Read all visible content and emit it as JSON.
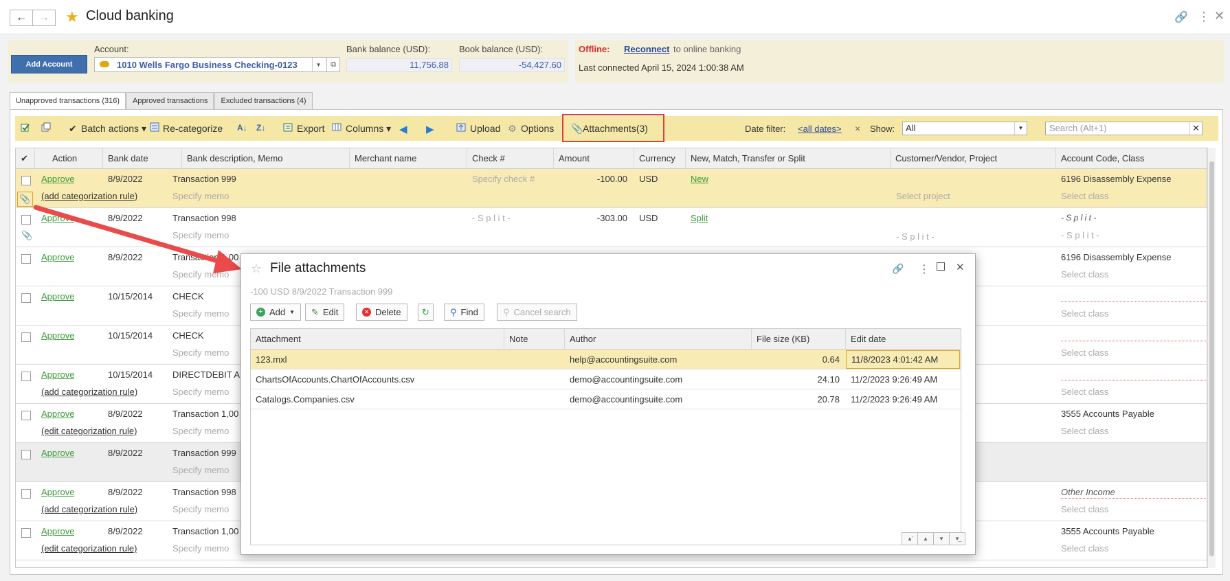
{
  "window": {
    "title": "Cloud banking"
  },
  "header": {
    "add_account": "Add Account",
    "account_label": "Account:",
    "account_value": "1010 Wells Fargo Business Checking-0123",
    "bank_balance_label": "Bank balance (USD):",
    "bank_balance": "11,756.88",
    "book_balance_label": "Book balance (USD):",
    "book_balance": "-54,427.60",
    "offline_label": "Offline:",
    "reconnect": "Reconnect",
    "reconnect_tail": "to online banking",
    "last_connected": "Last connected April 15, 2024 1:00:38 AM"
  },
  "tabs": [
    {
      "label": "Unapproved transactions (316)"
    },
    {
      "label": "Approved transactions"
    },
    {
      "label": "Excluded transactions (4)"
    }
  ],
  "toolbar": {
    "batch_actions": "Batch actions",
    "recategorize": "Re-categorize",
    "export": "Export",
    "columns": "Columns",
    "upload": "Upload",
    "options": "Options",
    "attachments": "Attachments(3)",
    "date_filter_label": "Date filter:",
    "date_filter_value": "<all dates>",
    "clear": "×",
    "show_label": "Show:",
    "show_value": "All",
    "search_placeholder": "Search (Alt+1)"
  },
  "grid": {
    "columns": [
      "Action",
      "Bank date",
      "Bank description, Memo",
      "Merchant name",
      "Check #",
      "Amount",
      "Currency",
      "New, Match, Transfer or Split",
      "Customer/Vendor, Project",
      "Account Code, Class"
    ],
    "rows": [
      {
        "action": "Approve",
        "date": "8/9/2022",
        "desc": "Transaction 999",
        "memo": "Specify memo",
        "rule": "(add categorization rule)",
        "check": "Specify check #",
        "amount": "-100.00",
        "currency": "USD",
        "match": "New",
        "project": "Select project",
        "account": "6196 Disassembly Expense",
        "class": "Select class"
      },
      {
        "action": "Approve",
        "date": "8/9/2022",
        "desc": "Transaction 998",
        "memo": "Specify memo",
        "rule": "",
        "check": "- S p l i t -",
        "amount": "-303.00",
        "currency": "USD",
        "match": "Split",
        "project": "- S p l i t -",
        "account": "- S p l i t -",
        "class": "- S p l i t -"
      },
      {
        "action": "Approve",
        "date": "8/9/2022",
        "desc": "Transaction 1,00",
        "memo": "Specify memo",
        "rule": "",
        "account": "6196 Disassembly Expense",
        "class": "Select class"
      },
      {
        "action": "Approve",
        "date": "10/15/2014",
        "desc": "CHECK",
        "memo": "Specify memo",
        "rule": "",
        "account": "",
        "class": "Select class"
      },
      {
        "action": "Approve",
        "date": "10/15/2014",
        "desc": "CHECK",
        "memo": "Specify memo",
        "rule": "",
        "account": "",
        "class": "Select class"
      },
      {
        "action": "Approve",
        "date": "10/15/2014",
        "desc": "DIRECTDEBIT A",
        "memo": "Specify memo",
        "rule": "(add categorization rule)",
        "account": "",
        "class": "Select class"
      },
      {
        "action": "Approve",
        "date": "8/9/2022",
        "desc": "Transaction 1,00",
        "memo": "Specify memo",
        "rule": "(edit categorization rule)",
        "account": "3555 Accounts Payable",
        "class": "Select class"
      },
      {
        "action": "Approve",
        "date": "8/9/2022",
        "desc": "Transaction 999",
        "memo": "Specify memo",
        "rule": "",
        "account": "",
        "class": ""
      },
      {
        "action": "Approve",
        "date": "8/9/2022",
        "desc": "Transaction 998",
        "memo": "Specify memo",
        "rule": "(add categorization rule)",
        "account": "Other Income",
        "class": "Select class"
      },
      {
        "action": "Approve",
        "date": "8/9/2022",
        "desc": "Transaction 1,00",
        "memo": "Specify memo",
        "rule": "(edit categorization rule)",
        "account": "3555 Accounts Payable",
        "class": "Select class"
      }
    ]
  },
  "dialog": {
    "title": "File attachments",
    "subtitle": "-100 USD 8/9/2022 Transaction 999",
    "buttons": {
      "add": "Add",
      "edit": "Edit",
      "delete": "Delete",
      "find": "Find",
      "cancel_search": "Cancel search"
    },
    "columns": [
      "Attachment",
      "Note",
      "Author",
      "File size (KB)",
      "Edit date"
    ],
    "rows": [
      {
        "name": "123.mxl",
        "note": "",
        "author": "help@accountingsuite.com",
        "size": "0.64",
        "date": "11/8/2023 4:01:42 AM"
      },
      {
        "name": "ChartsOfAccounts.ChartOfAccounts.csv",
        "note": "",
        "author": "demo@accountingsuite.com",
        "size": "24.10",
        "date": "11/2/2023 9:26:49 AM"
      },
      {
        "name": "Catalogs.Companies.csv",
        "note": "",
        "author": "demo@accountingsuite.com",
        "size": "20.78",
        "date": "11/2/2023 9:26:49 AM"
      }
    ]
  },
  "colors": {
    "accent": "#3f6fad",
    "highlight": "#f8ebb4",
    "toolbar": "#f5e8a6",
    "alert": "#d9423f",
    "link": "#3a9b3a"
  }
}
